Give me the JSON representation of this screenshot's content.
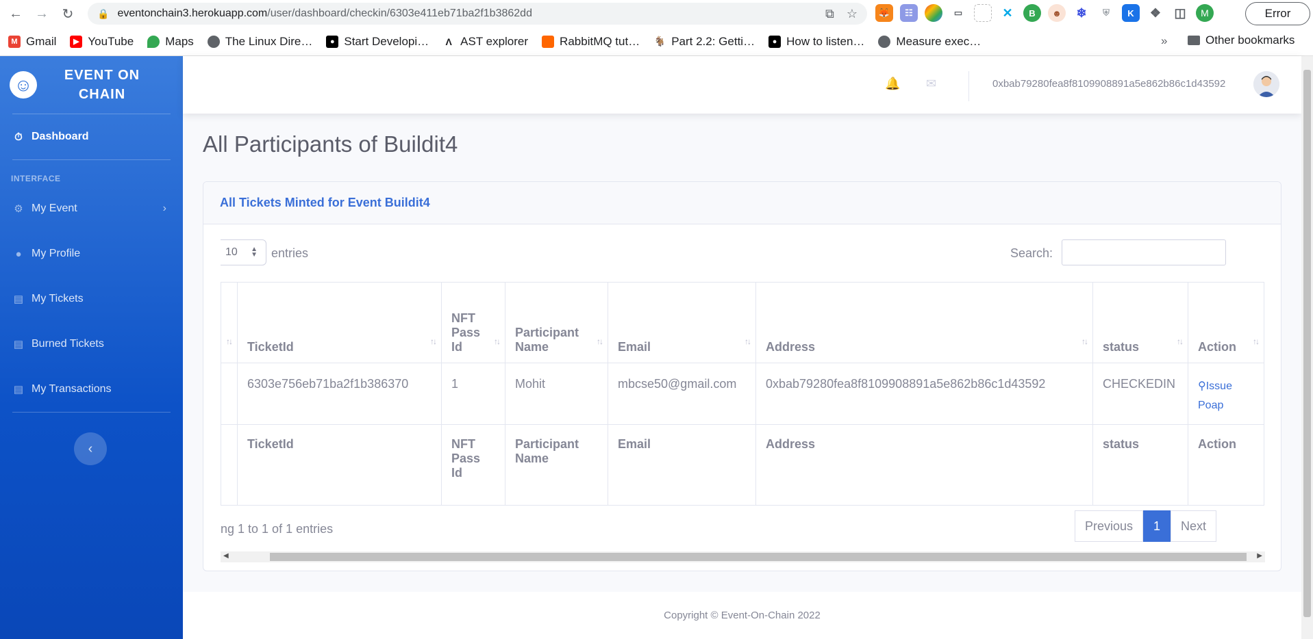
{
  "browser": {
    "url_host": "eventonchain3.herokuapp.com",
    "url_path": "/user/dashboard/checkin/6303e411eb71ba2f1b3862dd",
    "profile_initial": "M",
    "error_label": "Error",
    "bookmarks": [
      {
        "label": "Gmail",
        "icon": "gmail-icon",
        "color": "#ea4335"
      },
      {
        "label": "YouTube",
        "icon": "youtube-icon",
        "color": "#ff0000"
      },
      {
        "label": "Maps",
        "icon": "maps-icon",
        "color": "#34a853"
      },
      {
        "label": "The Linux Dire…",
        "icon": "globe-icon",
        "color": "#5f6368"
      },
      {
        "label": "Start Developi…",
        "icon": "medium-icon",
        "color": "#000000"
      },
      {
        "label": "AST explorer",
        "icon": "ast-icon",
        "color": "#202124"
      },
      {
        "label": "RabbitMQ tut…",
        "icon": "rabbitmq-icon",
        "color": "#ff6600"
      },
      {
        "label": "Part 2.2: Getti…",
        "icon": "goat-icon",
        "color": "#888888"
      },
      {
        "label": "How to listen…",
        "icon": "medium-icon",
        "color": "#000000"
      },
      {
        "label": "Measure exec…",
        "icon": "globe-icon",
        "color": "#5f6368"
      }
    ],
    "bookmarks_more": "»",
    "other_bookmarks": "Other bookmarks"
  },
  "sidebar": {
    "brand_line1": "EVENT ON",
    "brand_line2": "CHAIN",
    "dashboard": "Dashboard",
    "heading": "INTERFACE",
    "items": [
      {
        "label": "My Event",
        "icon": "gear-icon"
      },
      {
        "label": "My Profile",
        "icon": "user-icon"
      },
      {
        "label": "My Tickets",
        "icon": "ticket-icon"
      },
      {
        "label": "Burned Tickets",
        "icon": "ticket-icon"
      },
      {
        "label": "My Transactions",
        "icon": "receipt-icon"
      }
    ]
  },
  "topbar": {
    "wallet": "0xbab79280fea8f8109908891a5e862b86c1d43592"
  },
  "page": {
    "title": "All Participants of Buildit4"
  },
  "card": {
    "header": "All Tickets Minted for Event Buildit4",
    "length_value": "10",
    "length_label": "entries",
    "search_label": "Search:",
    "columns": [
      {
        "line1": "",
        "line2": "",
        "line3": ""
      },
      {
        "line1": "",
        "line2": "",
        "line3": "TicketId"
      },
      {
        "line1": "NFT",
        "line2": "Pass",
        "line3": "Id"
      },
      {
        "line1": "",
        "line2": "Participant",
        "line3": "Name"
      },
      {
        "line1": "",
        "line2": "",
        "line3": "Email"
      },
      {
        "line1": "",
        "line2": "",
        "line3": "Address"
      },
      {
        "line1": "",
        "line2": "",
        "line3": "status"
      },
      {
        "line1": "",
        "line2": "",
        "line3": "Action"
      }
    ],
    "row": {
      "ticket_id": "6303e756eb71ba2f1b386370",
      "nft_pass_id": "1",
      "participant_name": "Mohit",
      "email": "mbcse50@gmail.com",
      "address": "0xbab79280fea8f8109908891a5e862b86c1d43592",
      "status": "CHECKEDIN",
      "action_line1": "Issue",
      "action_line2": "Poap"
    },
    "footer_cols": {
      "ticket_id": "TicketId",
      "nft1": "NFT",
      "nft2": "Pass",
      "nft3": "Id",
      "pn1": "Participant",
      "pn2": "Name",
      "email": "Email",
      "address": "Address",
      "status": "status",
      "action": "Action"
    },
    "info": "ng 1 to 1 of 1 entries",
    "pagination": {
      "previous": "Previous",
      "current": "1",
      "next": "Next"
    }
  },
  "footer": {
    "copyright": "Copyright © Event-On-Chain 2022"
  }
}
